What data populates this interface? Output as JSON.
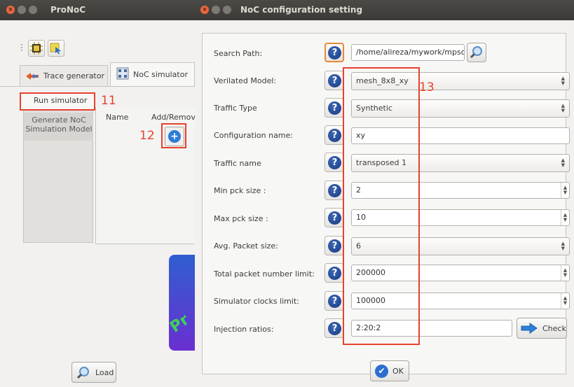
{
  "left_window": {
    "title": "ProNoC",
    "tabs": [
      {
        "label": "Trace generator"
      },
      {
        "label": "NoC simulator"
      }
    ],
    "sidetabs": {
      "run_label": "Run simulator",
      "generate_label": "Generate NoC\nSimulation Model"
    },
    "table": {
      "col_name": "Name",
      "col_add": "Add/Remov"
    },
    "load_label": "Load"
  },
  "annotations": {
    "run": "11",
    "add": "12",
    "column": "13"
  },
  "dialog": {
    "title": "NoC configuration setting",
    "rows": [
      {
        "label": "Search Path:",
        "value": "/home/alireza/mywork/mpso"
      },
      {
        "label": "Verilated Model:",
        "value": "mesh_8x8_xy"
      },
      {
        "label": "Traffic Type",
        "value": "Synthetic"
      },
      {
        "label": "Configuration name:",
        "value": "xy"
      },
      {
        "label": "Traffic name",
        "value": "transposed 1"
      },
      {
        "label": "Min pck size :",
        "value": "2"
      },
      {
        "label": "Max pck size :",
        "value": "10"
      },
      {
        "label": "Avg. Packet size:",
        "value": "6"
      },
      {
        "label": "Total packet number limit:",
        "value": "200000"
      },
      {
        "label": "Simulator clocks limit:",
        "value": "100000"
      },
      {
        "label": "Injection ratios:",
        "value": "2:20:2"
      }
    ],
    "check_label": "Check",
    "ok_label": "OK"
  },
  "colors": {
    "accent_red": "#e8412f",
    "help_blue": "#1f4a9a",
    "focus_orange": "#e8883a"
  }
}
